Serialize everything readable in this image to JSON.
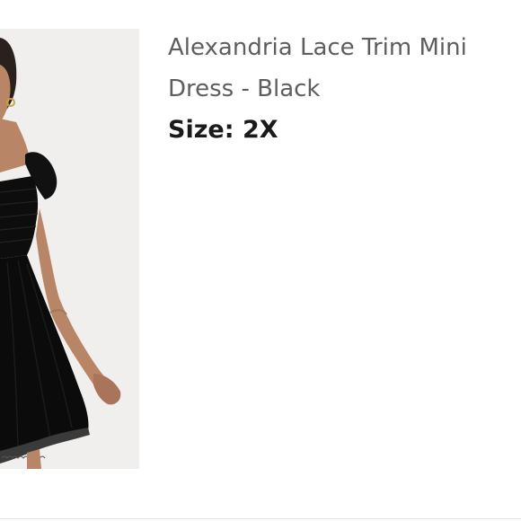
{
  "product": {
    "title": "Alexandria Lace Trim Mini Dress - Black",
    "size_label": "Size:",
    "size_value": "2X",
    "image_icon": "product-photo-black-lace-trim-mini-dress"
  },
  "colors": {
    "title_text": "#5e5e5e",
    "size_text": "#1a1a1a",
    "image_background": "#f0efed",
    "dress": "#0d0d0d",
    "skin": "#b98567"
  }
}
